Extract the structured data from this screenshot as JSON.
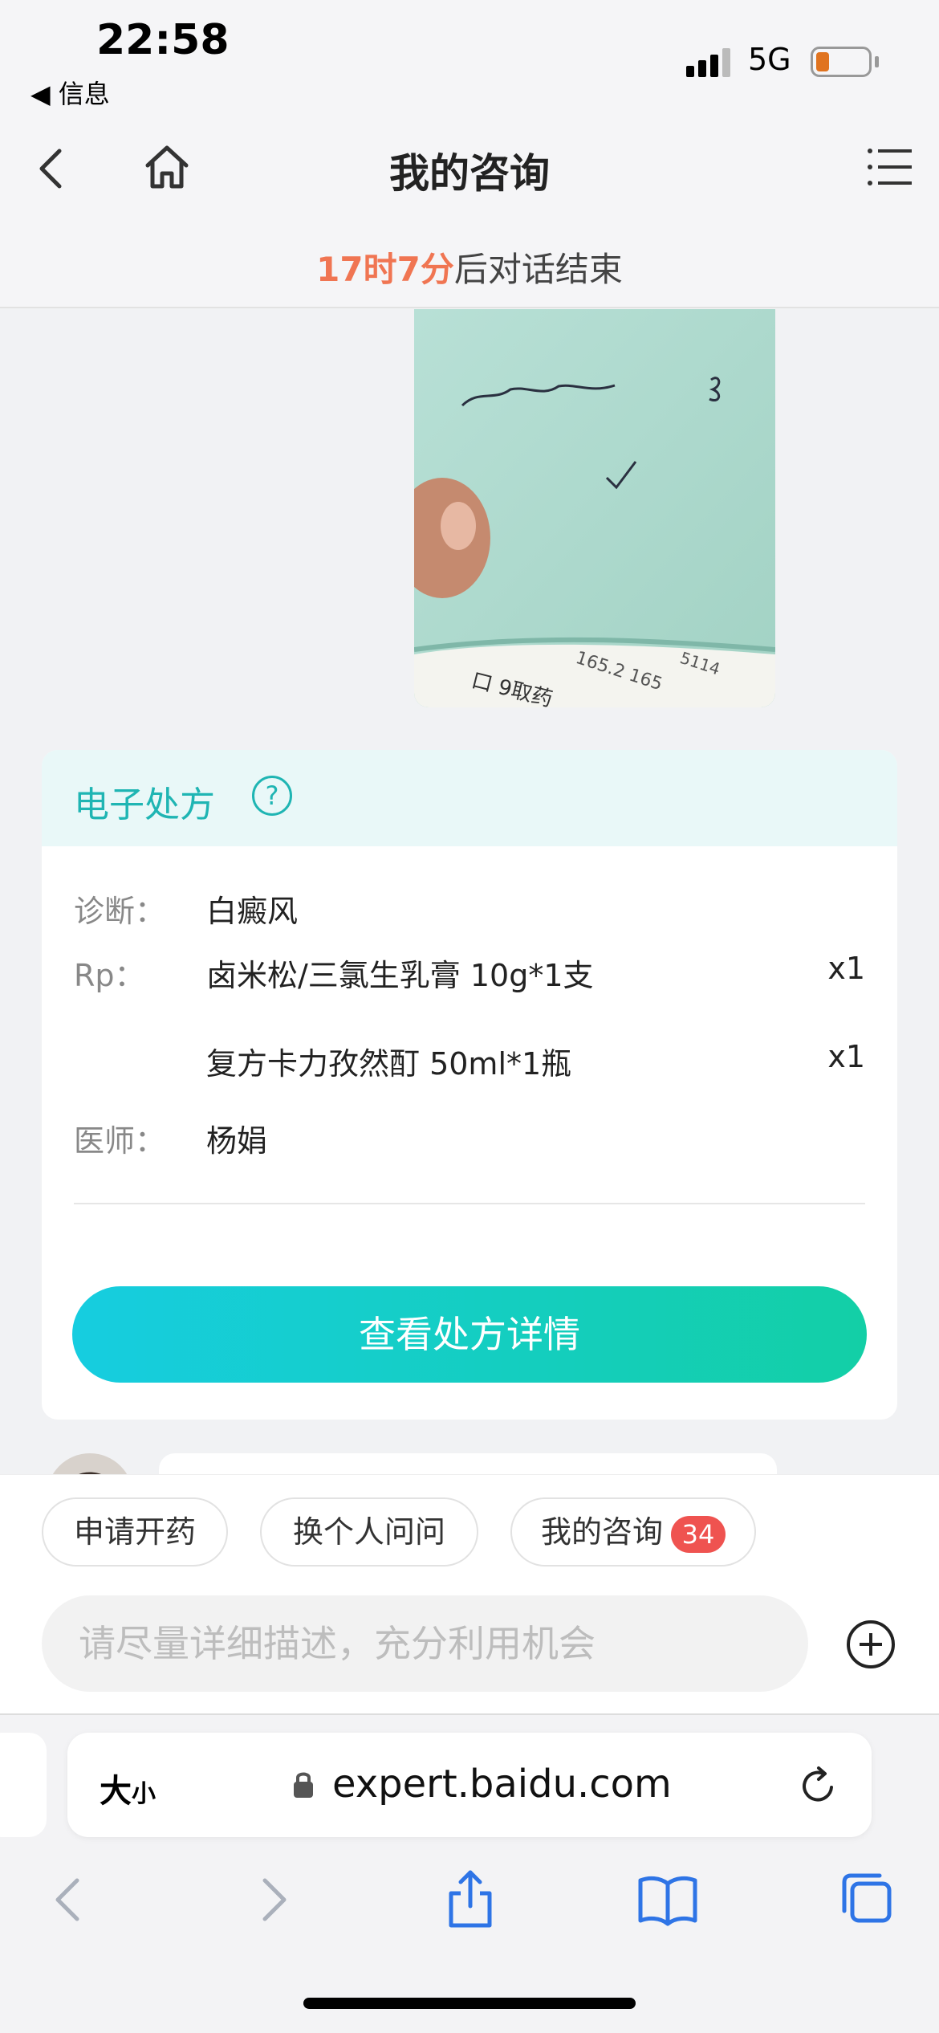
{
  "status_bar": {
    "time": "22:58",
    "back_app": "◀ 信息",
    "network": "5G",
    "battery_color": "#e0731f"
  },
  "nav": {
    "title": "我的咨询",
    "icons": [
      "back-icon",
      "home-icon",
      "menu-icon"
    ]
  },
  "countdown": {
    "time_left": "17时7分",
    "suffix": "后对话结束"
  },
  "photo": {
    "description_icon": "handwritten-note-photo"
  },
  "prescription": {
    "title": "电子处方",
    "help_symbol": "?",
    "diagnosis_label": "诊断：",
    "diagnosis": "白癜风",
    "rp_label": "Rp：",
    "items": [
      {
        "name": "卤米松/三氯生乳膏 10g*1支",
        "qty": "x1"
      },
      {
        "name": "复方卡力孜然酊 50ml*1瓶",
        "qty": "x1"
      }
    ],
    "doctor_label": "医师：",
    "doctor": "杨娟",
    "button_label": "查看处方详情",
    "accent_color": "#1fb5b3"
  },
  "actions": {
    "chips": [
      {
        "label": "申请开药"
      },
      {
        "label": "换个人问问"
      },
      {
        "label": "我的咨询",
        "badge": "34"
      }
    ],
    "input_placeholder": "请尽量详细描述，充分利用机会"
  },
  "browser": {
    "text_size_label": "大",
    "text_size_small": "小",
    "url": "expert.baidu.com",
    "toolbar_icons": [
      "back-icon",
      "forward-icon",
      "share-icon",
      "bookmarks-icon",
      "tabs-icon"
    ]
  }
}
